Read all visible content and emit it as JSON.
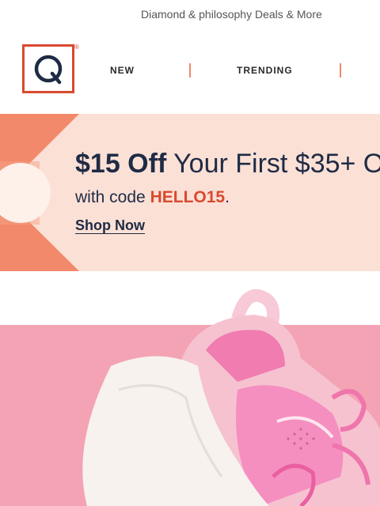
{
  "preheader": {
    "text": "Diamond & philosophy Deals & More"
  },
  "logo": {
    "letter": "Q",
    "mark": "®",
    "color": "#d94a2e"
  },
  "nav": {
    "items": [
      {
        "label": "NEW"
      },
      {
        "label": "TRENDING"
      }
    ]
  },
  "promo": {
    "headline_bold": "$15 Off",
    "headline_rest": " Your First $35+ O",
    "subline_prefix": "with code ",
    "code": "HELLO15",
    "subline_suffix": ".",
    "cta": "Shop Now",
    "background": "#fbe0d6",
    "accent": "#f2896a"
  },
  "hero": {
    "image": "pink-sneaker",
    "background": "#f3a3b4"
  }
}
